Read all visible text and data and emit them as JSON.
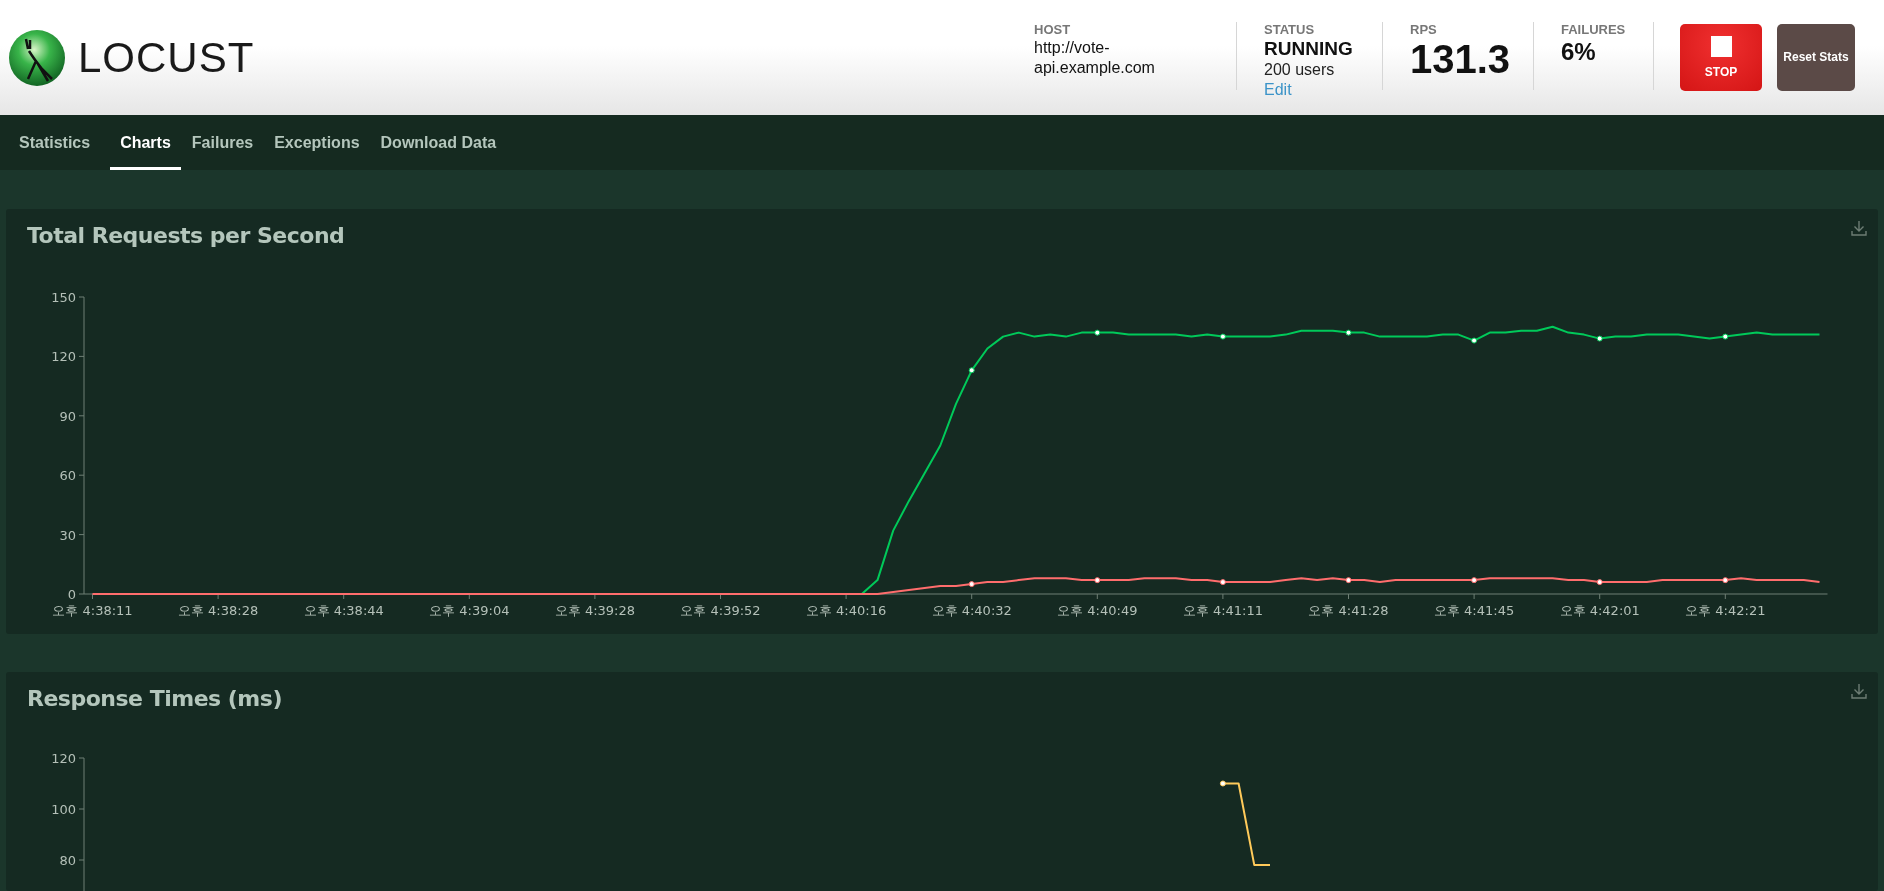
{
  "header": {
    "logo_text": "LOCUST",
    "stats": [
      {
        "label": "HOST",
        "value": "http://vote-api.example.com",
        "kind": "text"
      },
      {
        "label": "STATUS",
        "value": "RUNNING",
        "detail": "200 users",
        "link": "Edit",
        "kind": "status"
      },
      {
        "label": "RPS",
        "value": "131.3",
        "kind": "big"
      },
      {
        "label": "FAILURES",
        "value": "6%",
        "kind": "medium"
      }
    ],
    "buttons": [
      {
        "label": "STOP",
        "kind": "stop"
      },
      {
        "label": "Reset Stats",
        "kind": "reset"
      }
    ]
  },
  "tabs": [
    {
      "label": "Statistics",
      "selected": false
    },
    {
      "label": "Charts",
      "selected": true
    },
    {
      "label": "Failures",
      "selected": false
    },
    {
      "label": "Exceptions",
      "selected": false
    },
    {
      "label": "Download Data",
      "selected": false
    }
  ],
  "charts": [
    {
      "title": "Total Requests per Second",
      "chart_data": {
        "type": "line",
        "ylim": [
          0,
          150
        ],
        "yticks": [
          0,
          30,
          60,
          90,
          120,
          150
        ],
        "categories": [
          "오후 4:38:11",
          null,
          null,
          null,
          null,
          null,
          null,
          null,
          "오후 4:38:28",
          null,
          null,
          null,
          null,
          null,
          null,
          null,
          "오후 4:38:44",
          null,
          null,
          null,
          null,
          null,
          null,
          null,
          "오후 4:39:04",
          null,
          null,
          null,
          null,
          null,
          null,
          null,
          "오후 4:39:28",
          null,
          null,
          null,
          null,
          null,
          null,
          null,
          "오후 4:39:52",
          null,
          null,
          null,
          null,
          null,
          null,
          null,
          "오후 4:40:16",
          null,
          null,
          null,
          null,
          null,
          null,
          null,
          "오후 4:40:32",
          null,
          null,
          null,
          null,
          null,
          null,
          null,
          "오후 4:40:49",
          null,
          null,
          null,
          null,
          null,
          null,
          null,
          "오후 4:41:11",
          null,
          null,
          null,
          null,
          null,
          null,
          null,
          "오후 4:41:28",
          null,
          null,
          null,
          null,
          null,
          null,
          null,
          "오후 4:41:45",
          null,
          null,
          null,
          null,
          null,
          null,
          null,
          "오후 4:42:01",
          null,
          null,
          null,
          null,
          null,
          null,
          null,
          "오후 4:42:21",
          null,
          null,
          null,
          null,
          null,
          null
        ],
        "series": [
          {
            "color": "#00ca5a",
            "values": [
              null,
              null,
              null,
              null,
              null,
              null,
              null,
              null,
              null,
              null,
              null,
              null,
              null,
              null,
              null,
              null,
              null,
              null,
              null,
              null,
              null,
              null,
              null,
              null,
              null,
              null,
              null,
              null,
              null,
              null,
              null,
              null,
              null,
              null,
              null,
              null,
              null,
              null,
              null,
              null,
              null,
              null,
              null,
              null,
              null,
              null,
              null,
              null,
              null,
              0,
              7,
              32,
              47,
              61,
              75,
              96,
              113,
              124,
              130,
              132,
              130,
              131,
              130,
              132,
              132,
              132,
              131,
              131,
              131,
              131,
              130,
              131,
              130,
              130,
              130,
              130,
              131,
              133,
              133,
              133,
              132,
              132,
              130,
              130,
              130,
              130,
              131,
              131,
              128,
              132,
              132,
              133,
              133,
              135,
              132,
              131,
              129,
              130,
              130,
              131,
              131,
              131,
              130,
              129,
              130,
              131,
              132,
              131,
              131,
              131,
              131
            ]
          },
          {
            "color": "#ff6d6d",
            "values": [
              0,
              0,
              0,
              0,
              0,
              0,
              0,
              0,
              0,
              0,
              0,
              0,
              0,
              0,
              0,
              0,
              0,
              0,
              0,
              0,
              0,
              0,
              0,
              0,
              0,
              0,
              0,
              0,
              0,
              0,
              0,
              0,
              0,
              0,
              0,
              0,
              0,
              0,
              0,
              0,
              0,
              0,
              0,
              0,
              0,
              0,
              0,
              0,
              0,
              0,
              0,
              1,
              2,
              3,
              4,
              4,
              5,
              6,
              6,
              7,
              8,
              8,
              8,
              7,
              7,
              7,
              7,
              8,
              8,
              8,
              7,
              7,
              6,
              6,
              6,
              6,
              7,
              8,
              7,
              8,
              7,
              7,
              6,
              7,
              7,
              7,
              7,
              7,
              7,
              8,
              8,
              8,
              8,
              8,
              7,
              7,
              6,
              6,
              6,
              6,
              7,
              7,
              7,
              7,
              7,
              8,
              7,
              7,
              7,
              7,
              6
            ]
          }
        ]
      }
    },
    {
      "title": "Response Times (ms)",
      "chart_data": {
        "type": "line",
        "ylim": [
          0,
          120
        ],
        "yticks": [
          80,
          100,
          120
        ],
        "categories": [
          null,
          null,
          null,
          null,
          null,
          null,
          null,
          null,
          null,
          null,
          null,
          null,
          null,
          null,
          null,
          null,
          null,
          null,
          null,
          null,
          null,
          null,
          null,
          null,
          null,
          null,
          null,
          null,
          null,
          null,
          null,
          null,
          null,
          null,
          null,
          null,
          null,
          null,
          null,
          null,
          null,
          null,
          null,
          null,
          null,
          null,
          null,
          null,
          null,
          null,
          null,
          null,
          null,
          null,
          null,
          null,
          null,
          null,
          null,
          null,
          null,
          null,
          null,
          null,
          null,
          null,
          null,
          null,
          null,
          null,
          null,
          null,
          null,
          null,
          null,
          null,
          null,
          null,
          null,
          null,
          null,
          null,
          null,
          null,
          null,
          null,
          null,
          null,
          null,
          null,
          null,
          null,
          null,
          null,
          null,
          null,
          null,
          null,
          null,
          null,
          null,
          null,
          null,
          null,
          null,
          null,
          null,
          null,
          null,
          null,
          null
        ],
        "series": [
          {
            "color": "#ffca5a",
            "values": [
              null,
              null,
              null,
              null,
              null,
              null,
              null,
              null,
              null,
              null,
              null,
              null,
              null,
              null,
              null,
              null,
              null,
              null,
              null,
              null,
              null,
              null,
              null,
              null,
              null,
              null,
              null,
              null,
              null,
              null,
              null,
              null,
              null,
              null,
              null,
              null,
              null,
              null,
              null,
              null,
              null,
              null,
              null,
              null,
              null,
              null,
              null,
              null,
              null,
              null,
              null,
              null,
              null,
              null,
              null,
              null,
              null,
              null,
              null,
              null,
              null,
              null,
              null,
              null,
              null,
              null,
              null,
              null,
              null,
              null,
              null,
              null,
              110,
              110,
              78,
              78,
              null,
              null,
              null,
              null,
              null,
              null,
              null,
              null,
              null,
              null,
              null,
              null,
              null,
              null,
              null,
              null,
              null,
              null,
              null,
              null,
              null,
              null,
              null,
              null,
              null,
              null,
              null,
              null,
              null,
              null,
              null,
              null,
              null,
              null,
              null
            ]
          }
        ]
      }
    }
  ]
}
